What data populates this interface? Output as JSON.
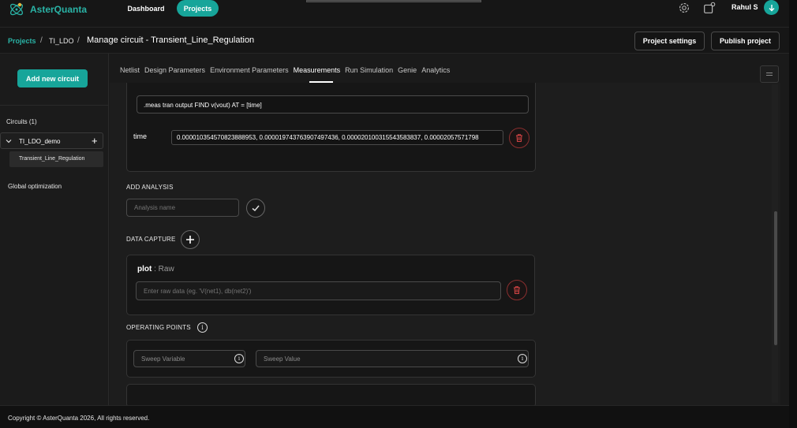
{
  "app": {
    "name": "AsterQuanta",
    "brand_color": "#17a59a"
  },
  "topnav": {
    "dashboard": "Dashboard",
    "projects": "Projects",
    "user": "Rahul S"
  },
  "breadcrumb": {
    "projects": "Projects",
    "sep": "/",
    "project": "TI_LDO",
    "page": "Manage circuit - Transient_Line_Regulation"
  },
  "header_actions": {
    "settings": "Project settings",
    "publish": "Publish project"
  },
  "sidebar": {
    "add_circuit": "Add new circuit",
    "circuits_label": "Circuits (1)",
    "circuit_name": "TI_LDO_demo",
    "plus": "+",
    "subcircuit": "Transient_Line_Regulation",
    "global_opt": "Global optimization"
  },
  "tabs": [
    {
      "label": "Netlist"
    },
    {
      "label": "Design Parameters"
    },
    {
      "label": "Environment Parameters"
    },
    {
      "label": "Measurements"
    },
    {
      "label": "Run Simulation"
    },
    {
      "label": "Genie"
    },
    {
      "label": "Analytics"
    }
  ],
  "active_tab": "Measurements",
  "measurement": {
    "expression": ".meas tran output FIND v(vout) AT = [time]",
    "time_label": "time",
    "time_values": "0.000010354570823888953, 0.000019743763907497436, 0.000020100315543583837, 0.00002057571798"
  },
  "add_analysis": {
    "label": "ADD ANALYSIS",
    "placeholder": "Analysis name"
  },
  "data_capture": {
    "label": "DATA CAPTURE",
    "plot_title": "plot",
    "plot_sep": " : ",
    "plot_type": "Raw",
    "placeholder": "Enter raw data (eg. 'V(net1), db(net2)')"
  },
  "operating_points": {
    "label": "OPERATING POINTS",
    "sweep_variable": "Sweep Variable",
    "sweep_value": "Sweep Value",
    "info": "i"
  },
  "footer": {
    "copyright": "Copyright © AsterQuanta 2026, All rights reserved."
  }
}
